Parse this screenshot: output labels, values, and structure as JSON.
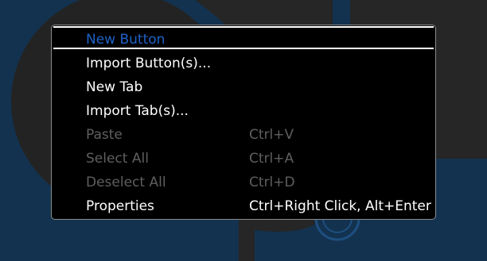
{
  "colors": {
    "background": "#262626",
    "decor_blue": "#13324f",
    "menu_background": "#000000",
    "menu_border": "#8c8c8c",
    "text_enabled": "#ffffff",
    "text_disabled": "#5f5f5f",
    "text_highlight": "#1f62c7"
  },
  "context_menu": {
    "items": [
      {
        "label": "New Button",
        "shortcut": "",
        "enabled": true,
        "highlighted": true
      },
      {
        "label": "Import Button(s)...",
        "shortcut": "",
        "enabled": true,
        "highlighted": false
      },
      {
        "label": "New Tab",
        "shortcut": "",
        "enabled": true,
        "highlighted": false
      },
      {
        "label": "Import Tab(s)...",
        "shortcut": "",
        "enabled": true,
        "highlighted": false
      },
      {
        "label": "Paste",
        "shortcut": "Ctrl+V",
        "enabled": false,
        "highlighted": false
      },
      {
        "label": "Select All",
        "shortcut": "Ctrl+A",
        "enabled": false,
        "highlighted": false
      },
      {
        "label": "Deselect All",
        "shortcut": "Ctrl+D",
        "enabled": false,
        "highlighted": false
      },
      {
        "label": "Properties",
        "shortcut": "Ctrl+Right Click, Alt+Enter",
        "enabled": true,
        "highlighted": false
      }
    ]
  }
}
